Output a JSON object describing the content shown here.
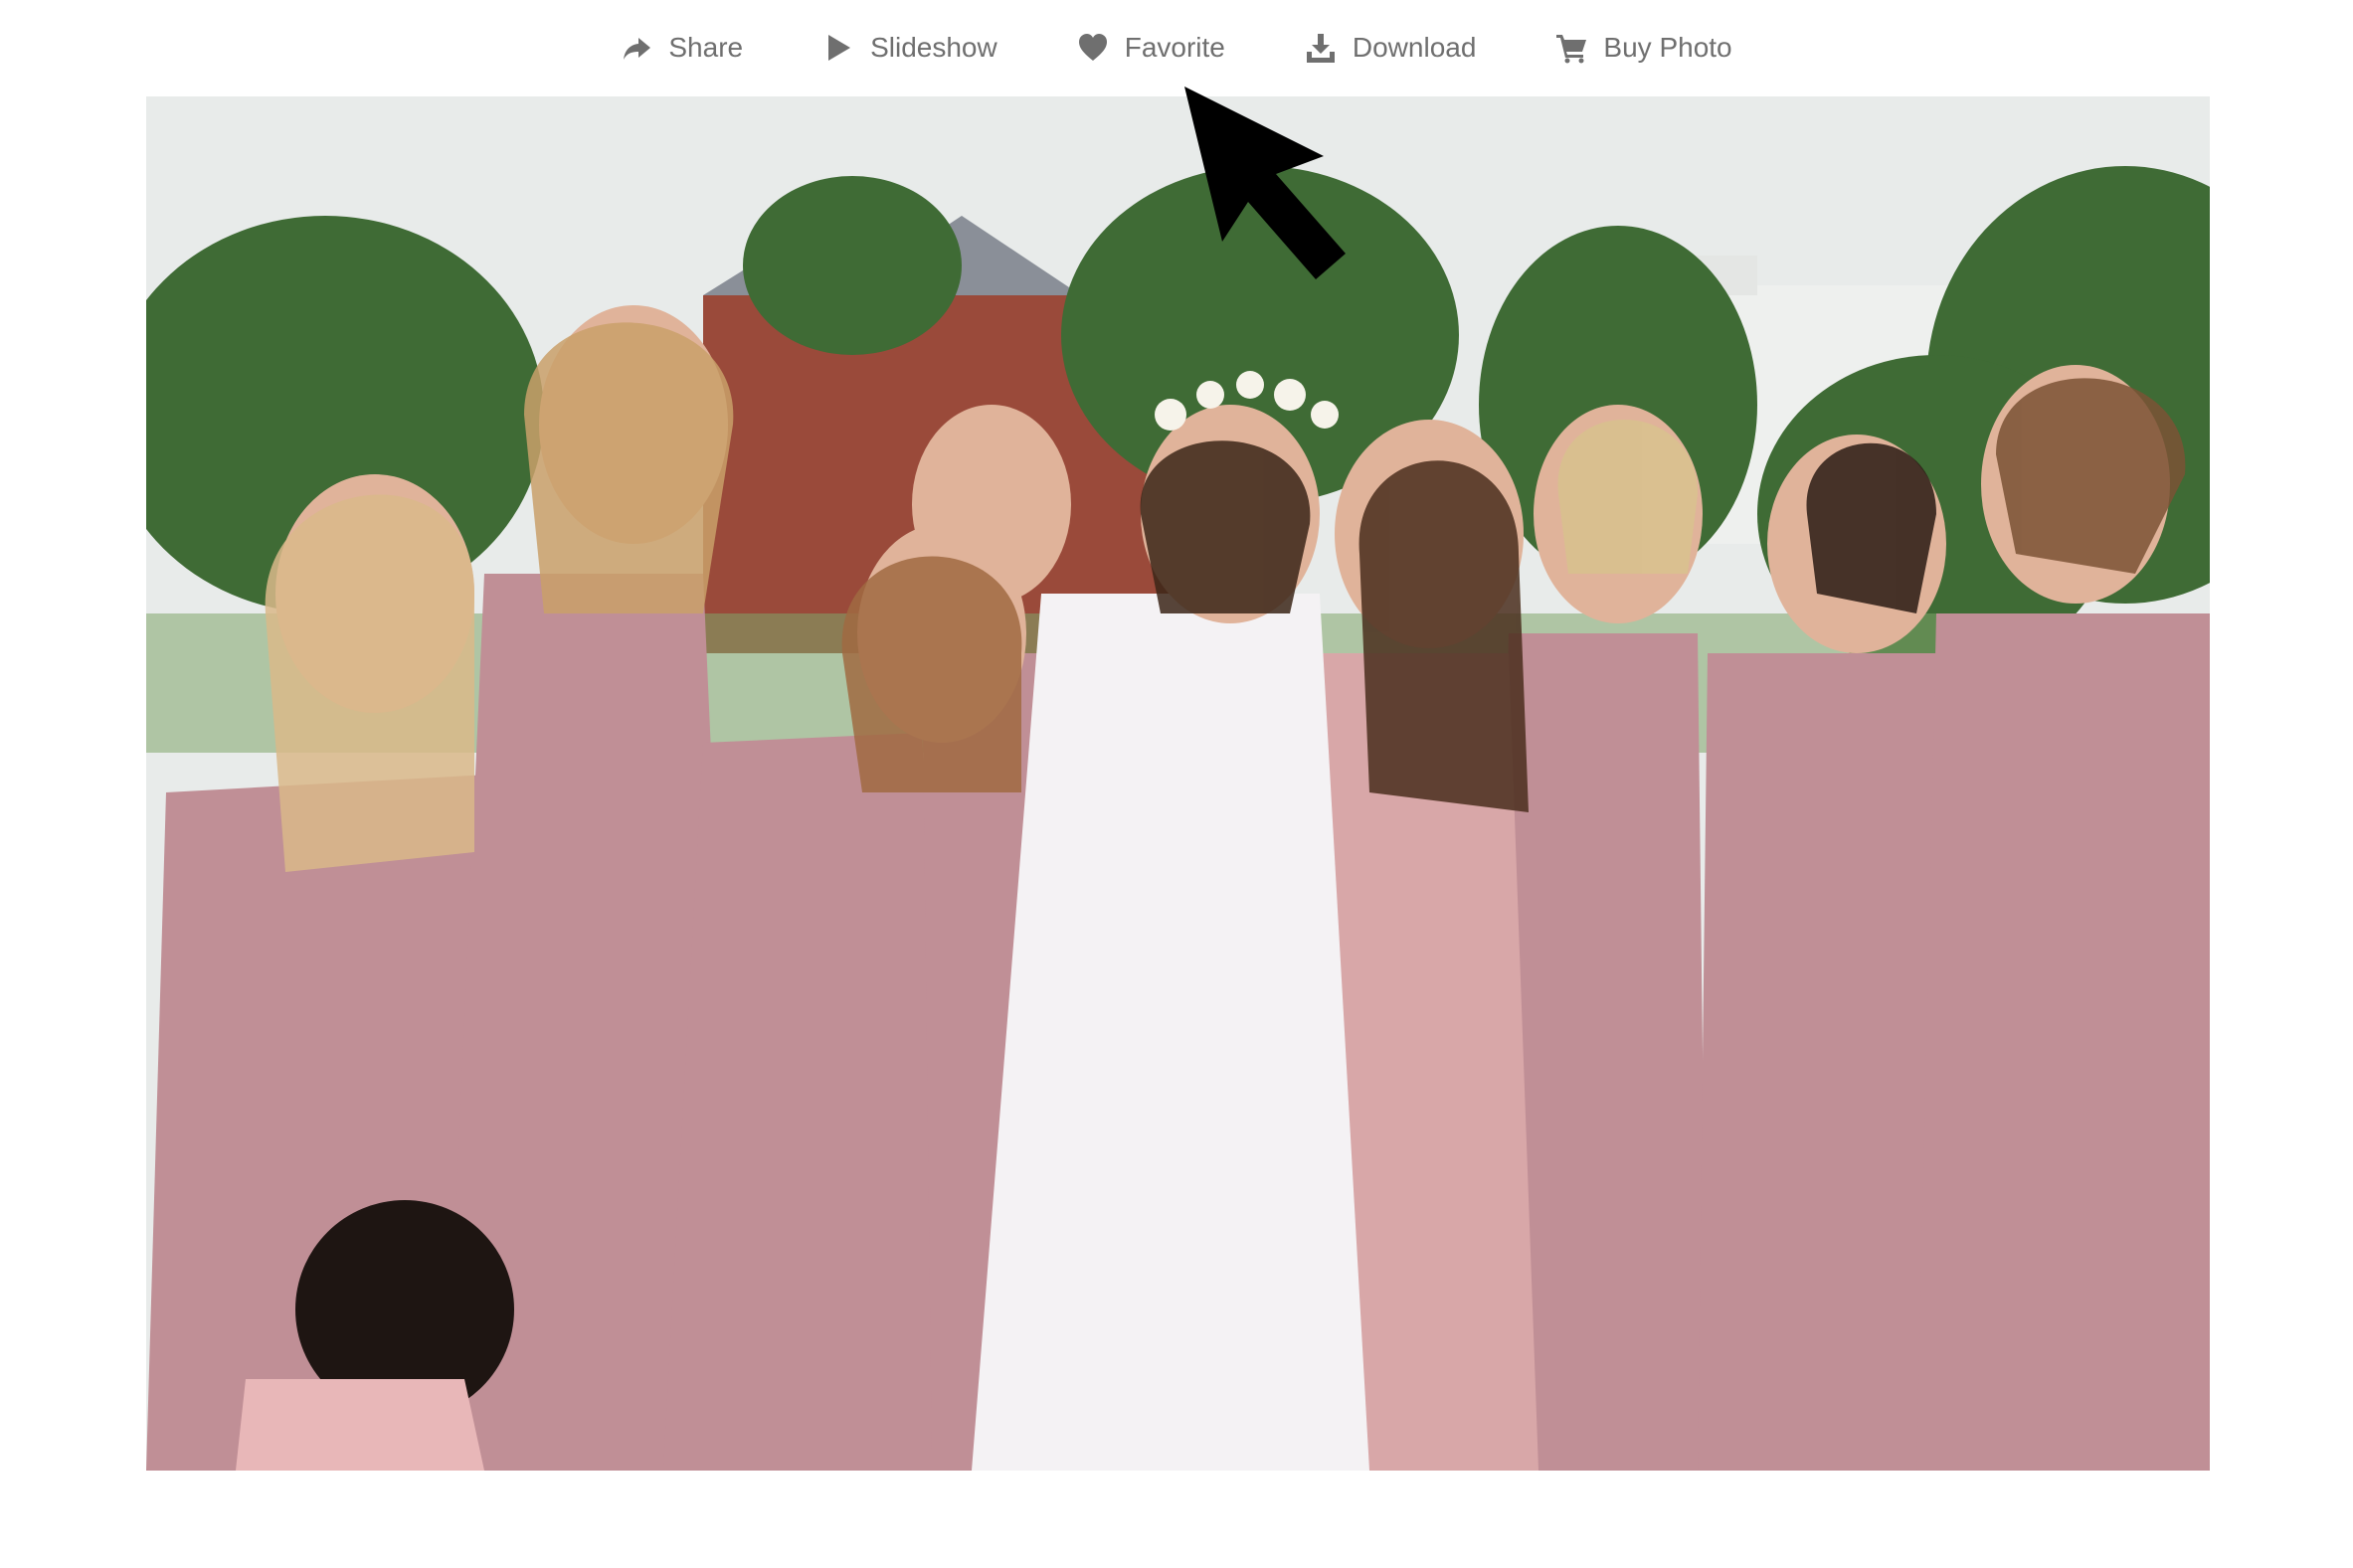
{
  "toolbar": {
    "items": [
      {
        "label": "Share",
        "icon": "share-icon"
      },
      {
        "label": "Slideshow",
        "icon": "play-icon"
      },
      {
        "label": "Favorite",
        "icon": "heart-icon"
      },
      {
        "label": "Download",
        "icon": "download-icon"
      },
      {
        "label": "Buy Photo",
        "icon": "cart-icon"
      }
    ],
    "color": "#6f6f6f"
  },
  "photo": {
    "subject": "wedding group photo",
    "colors": {
      "sky": "#e9ecec",
      "trees": "#3f6b35",
      "building_brick": "#9a4a3a",
      "dress": "#c08f96",
      "bride_dress": "#f4f2f4"
    }
  },
  "cursor": {
    "icon": "arrow-cursor-icon"
  }
}
